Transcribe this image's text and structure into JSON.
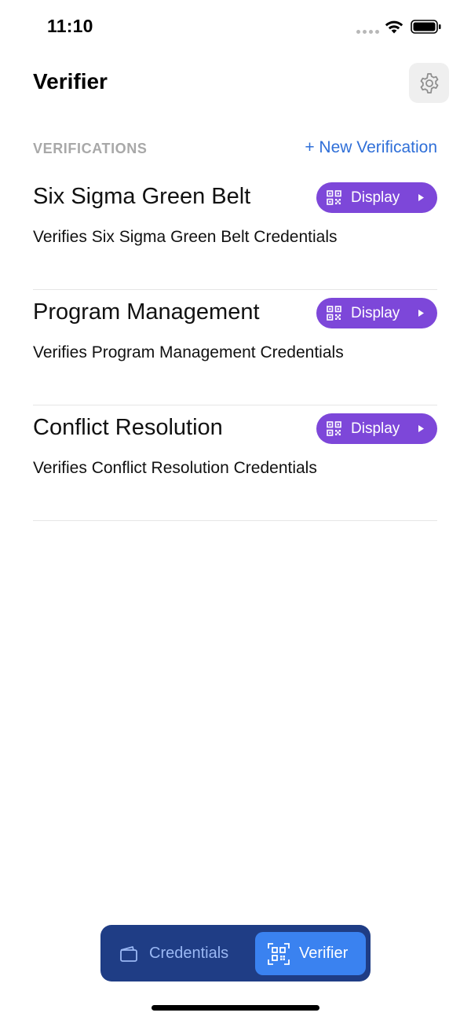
{
  "status_bar": {
    "time": "11:10"
  },
  "header": {
    "title": "Verifier"
  },
  "section": {
    "title": "VERIFICATIONS",
    "new_label": "+ New Verification"
  },
  "verifications": [
    {
      "title": "Six Sigma Green Belt",
      "description": "Verifies Six Sigma Green Belt Credentials",
      "button_label": "Display"
    },
    {
      "title": "Program Management",
      "description": "Verifies Program Management Credentials",
      "button_label": "Display"
    },
    {
      "title": "Conflict Resolution",
      "description": "Verifies Conflict Resolution Credentials",
      "button_label": "Display"
    }
  ],
  "tab_bar": {
    "credentials_label": "Credentials",
    "verifier_label": "Verifier",
    "active": "verifier"
  },
  "colors": {
    "accent_purple": "#7d47d9",
    "link_blue": "#2f6fd8",
    "tab_bar_bg": "#1f3d85",
    "tab_active_bg": "#3a82f0"
  },
  "icons": {
    "settings": "gear-icon",
    "display": "qr-code-icon",
    "credentials_tab": "wallet-card-icon",
    "verifier_tab": "qr-scan-icon"
  }
}
